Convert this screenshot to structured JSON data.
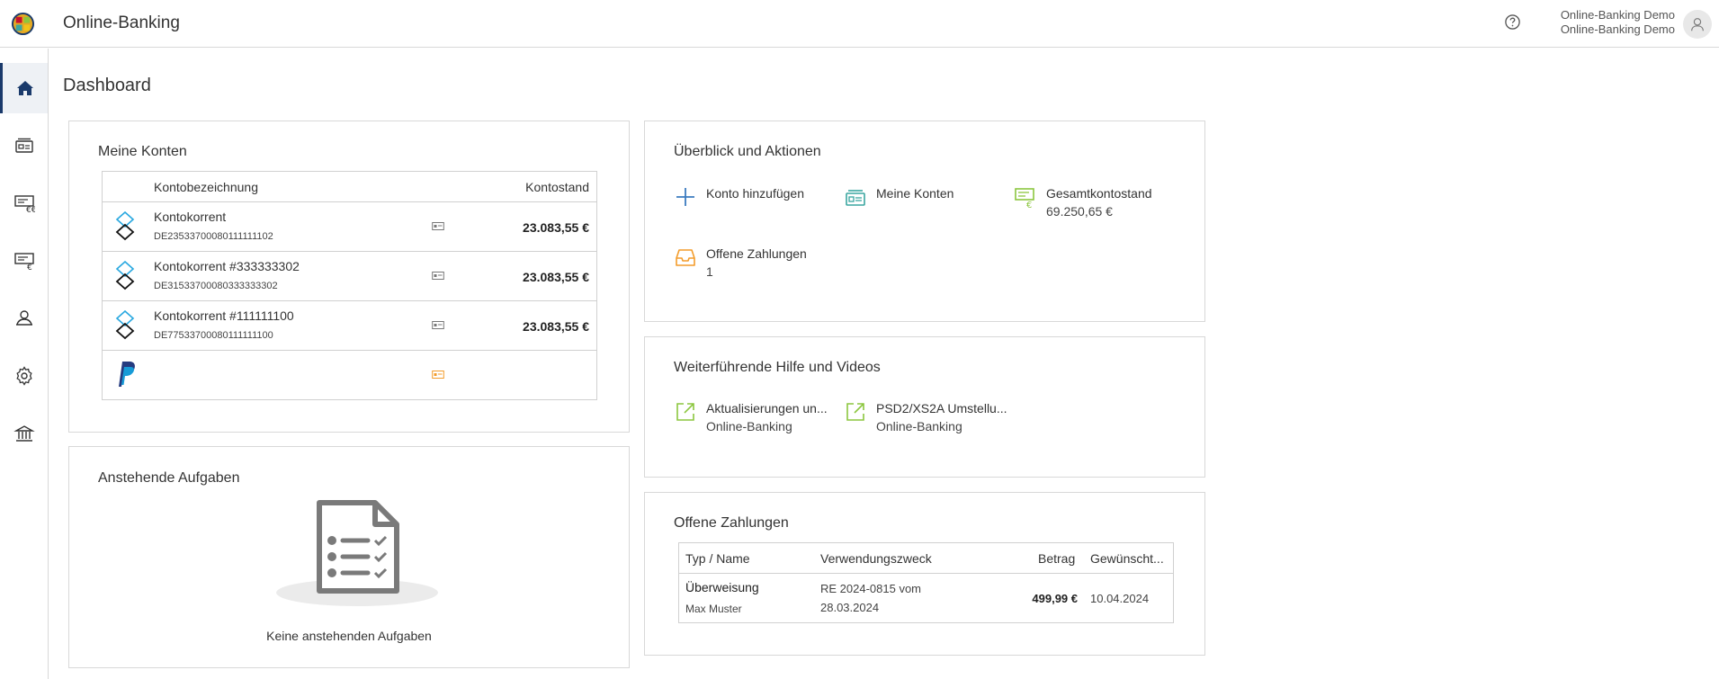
{
  "header": {
    "app_title": "Online-Banking",
    "user_line1": "Online-Banking Demo",
    "user_line2": "Online-Banking Demo"
  },
  "page": {
    "title": "Dashboard"
  },
  "accounts_card": {
    "title": "Meine Konten",
    "col_name": "Kontobezeichnung",
    "col_balance": "Kontostand",
    "rows": [
      {
        "name": "Kontokorrent",
        "iban": "DE23533700080111111102",
        "balance": "23.083,55 €"
      },
      {
        "name": "Kontokorrent #333333302",
        "iban": "DE31533700080333333302",
        "balance": "23.083,55 €"
      },
      {
        "name": "Kontokorrent #111111100",
        "iban": "DE77533700080111111100",
        "balance": "23.083,55 €"
      }
    ]
  },
  "overview_card": {
    "title": "Überblick und Aktionen",
    "add_account": "Konto hinzufügen",
    "my_accounts": "Meine Konten",
    "total_balance_label": "Gesamtkontostand",
    "total_balance_value": "69.250,65 €",
    "open_payments_label": "Offene Zahlungen",
    "open_payments_count": "1"
  },
  "help_card": {
    "title": "Weiterführende Hilfe und Videos",
    "links": [
      {
        "title": "Aktualisierungen un...",
        "sub": "Online-Banking"
      },
      {
        "title": "PSD2/XS2A Umstellu...",
        "sub": "Online-Banking"
      }
    ]
  },
  "tasks_card": {
    "title": "Anstehende Aufgaben",
    "empty_text": "Keine anstehenden Aufgaben"
  },
  "payments_card": {
    "title": "Offene Zahlungen",
    "col_type": "Typ / Name",
    "col_purpose": "Verwendungszweck",
    "col_amount": "Betrag",
    "col_date": "Gewünscht...",
    "row": {
      "type": "Überweisung",
      "name": "Max Muster",
      "purpose_line1": "RE 2024-0815 vom",
      "purpose_line2": "28.03.2024",
      "amount": "499,99 €",
      "date": "10.04.2024"
    }
  },
  "colors": {
    "accent_green": "#8cc63f",
    "accent_teal": "#3aa6a0",
    "accent_orange": "#f39c2b",
    "nav_active": "#1a3a6b",
    "plus_blue": "#3b7bbf"
  }
}
